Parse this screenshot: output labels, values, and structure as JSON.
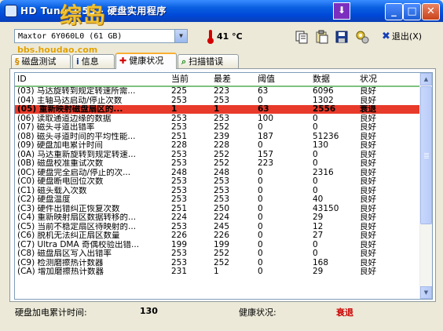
{
  "window": {
    "title": "HD Tune 2.53 - 硬盘实用程序",
    "watermark": "综岛",
    "url": "bbs.houdao.com"
  },
  "toolbar": {
    "drive": "Maxtor 6Y060L0 (61 GB)",
    "temperature": "41 °C",
    "exit_label": "退出(X)"
  },
  "tabs": [
    {
      "label": "磁盘测试",
      "icon": "benchmark-icon",
      "active": false
    },
    {
      "label": "信息",
      "icon": "info-icon",
      "active": false
    },
    {
      "label": "健康状况",
      "icon": "health-cross-icon",
      "active": true
    },
    {
      "label": "扫描错误",
      "icon": "scan-icon",
      "active": false
    }
  ],
  "table": {
    "columns": [
      "ID",
      "当前",
      "最差",
      "阈值",
      "数据",
      "状况"
    ],
    "rows": [
      [
        "(03) 马达旋转到规定转速所需...",
        "225",
        "223",
        "63",
        "6096",
        "良好"
      ],
      [
        "(04) 主轴马达启动/停止次数",
        "253",
        "253",
        "0",
        "1302",
        "良好"
      ],
      [
        "(05) 重新映射磁盘扇区的...",
        "1",
        "1",
        "63",
        "2556",
        "衰退"
      ],
      [
        "(06) 读取通道边缘的数据",
        "253",
        "253",
        "100",
        "0",
        "良好"
      ],
      [
        "(07) 磁头寻道出错率",
        "253",
        "252",
        "0",
        "0",
        "良好"
      ],
      [
        "(08) 磁头寻道时间的平均性能...",
        "251",
        "239",
        "187",
        "51236",
        "良好"
      ],
      [
        "(09) 硬盘加电累计时间",
        "228",
        "228",
        "0",
        "130",
        "良好"
      ],
      [
        "(0A) 马达重新旋转到规定转速...",
        "253",
        "252",
        "157",
        "0",
        "良好"
      ],
      [
        "(0B) 磁盘校准重试次数",
        "253",
        "252",
        "223",
        "0",
        "良好"
      ],
      [
        "(0C) 硬盘完全启动/停止的次...",
        "248",
        "248",
        "0",
        "2316",
        "良好"
      ],
      [
        "(C0) 硬盘断电回位次数",
        "253",
        "253",
        "0",
        "0",
        "良好"
      ],
      [
        "(C1) 磁头载入次数",
        "253",
        "253",
        "0",
        "0",
        "良好"
      ],
      [
        "(C2) 硬盘温度",
        "253",
        "253",
        "0",
        "40",
        "良好"
      ],
      [
        "(C3) 硬件出错纠正恢复次数",
        "251",
        "250",
        "0",
        "43150",
        "良好"
      ],
      [
        "(C4) 重新映射扇区数据转移的...",
        "224",
        "224",
        "0",
        "29",
        "良好"
      ],
      [
        "(C5) 当前不稳定扇区待映射的...",
        "253",
        "245",
        "0",
        "12",
        "良好"
      ],
      [
        "(C6) 脱机无法纠正扇区数量",
        "226",
        "226",
        "0",
        "27",
        "良好"
      ],
      [
        "(C7) Ultra DMA 奇偶校验出错...",
        "199",
        "199",
        "0",
        "0",
        "良好"
      ],
      [
        "(C8) 磁盘扇区写入出错率",
        "253",
        "252",
        "0",
        "0",
        "良好"
      ],
      [
        "(C9) 检测磨擦热计数器",
        "253",
        "252",
        "0",
        "168",
        "良好"
      ],
      [
        "(CA) 增加磨擦热计数器",
        "231",
        "1",
        "0",
        "29",
        "良好"
      ]
    ]
  },
  "footer": {
    "power_on_label": "硬盘加电累计时间:",
    "power_on_value": "130",
    "health_label": "健康状况:",
    "health_value": "衰退"
  },
  "colors": {
    "alert_row": "#e83a2a",
    "health_bad": "#cc0000",
    "titlebar": "#0a5fe0"
  }
}
